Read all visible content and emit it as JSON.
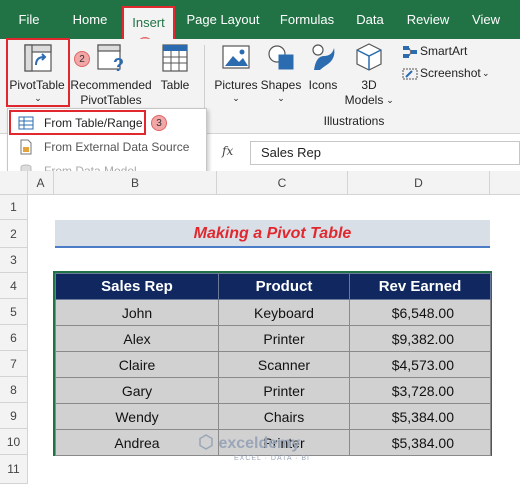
{
  "menu": {
    "tabs": [
      "File",
      "Home",
      "Insert",
      "Page Layout",
      "Formulas",
      "Data",
      "Review",
      "View"
    ],
    "active": "Insert"
  },
  "ribbon": {
    "pivottable": "PivotTable",
    "recommended_line1": "Recommended",
    "recommended_line2": "PivotTables",
    "table": "Table",
    "pictures": "Pictures",
    "shapes": "Shapes",
    "icons": "Icons",
    "models_line1": "3D",
    "models_line2": "Models",
    "smartart": "SmartArt",
    "screenshot": "Screenshot",
    "group_illustrations": "Illustrations"
  },
  "steps": [
    "1",
    "2",
    "3"
  ],
  "dropdown": {
    "items": [
      "From Table/Range",
      "From External Data Source",
      "From Data Model"
    ]
  },
  "formula_bar": {
    "fx": "fx",
    "value": "Sales Rep"
  },
  "columns": [
    "A",
    "B",
    "C",
    "D"
  ],
  "rows": [
    "1",
    "2",
    "3",
    "4",
    "5",
    "6",
    "7",
    "8",
    "9",
    "10",
    "11"
  ],
  "sheet": {
    "title": "Making a Pivot Table",
    "headers": [
      "Sales Rep",
      "Product",
      "Rev Earned"
    ],
    "records": [
      [
        "John",
        "Keyboard",
        "$6,548.00"
      ],
      [
        "Alex",
        "Printer",
        "$9,382.00"
      ],
      [
        "Claire",
        "Scanner",
        "$4,573.00"
      ],
      [
        "Gary",
        "Printer",
        "$3,728.00"
      ],
      [
        "Wendy",
        "Chairs",
        "$5,384.00"
      ],
      [
        "Andrea",
        "Printer",
        "$5,384.00"
      ]
    ]
  },
  "watermark": {
    "name": "exceldemy",
    "tagline": "EXCEL · DATA · BI"
  },
  "colors": {
    "excel_green": "#217346",
    "header_navy": "#10285f",
    "highlight_red": "#e0282e"
  }
}
